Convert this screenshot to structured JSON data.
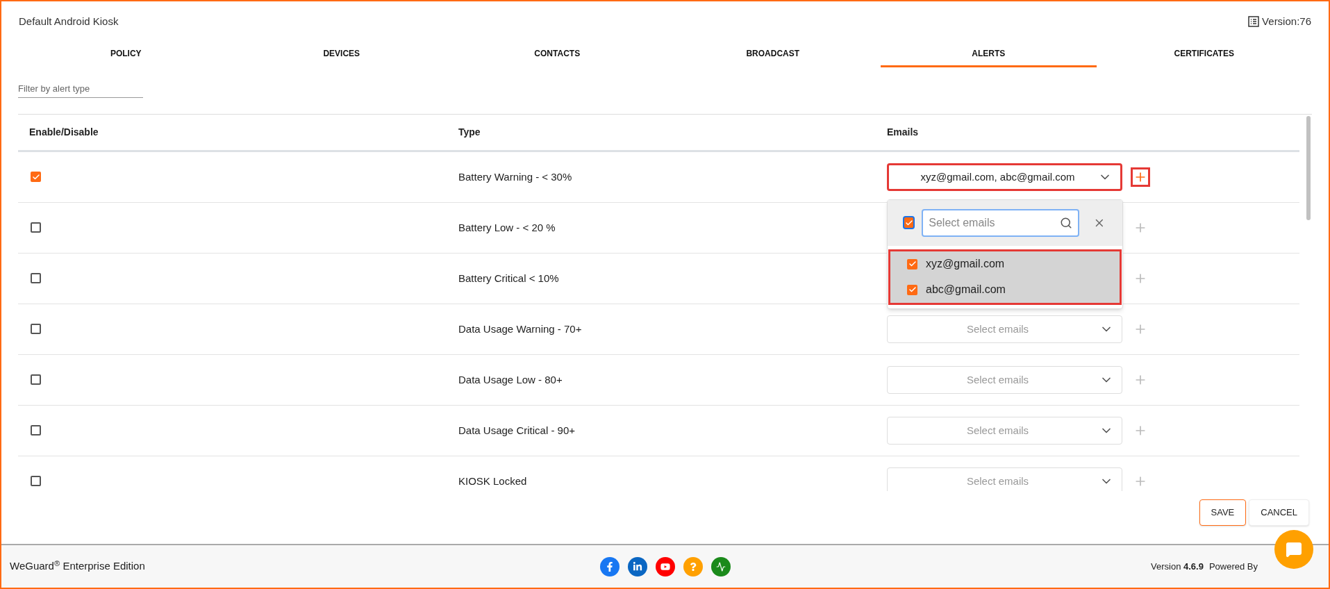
{
  "header": {
    "title": "Default Android Kiosk",
    "version": "Version:76"
  },
  "tabs": [
    {
      "label": "POLICY",
      "selected": false
    },
    {
      "label": "DEVICES",
      "selected": false
    },
    {
      "label": "CONTACTS",
      "selected": false
    },
    {
      "label": "BROADCAST",
      "selected": false
    },
    {
      "label": "ALERTS",
      "selected": true
    },
    {
      "label": "CERTIFICATES",
      "selected": false
    }
  ],
  "filter": {
    "placeholder": "Filter by alert type"
  },
  "table": {
    "columns": [
      "Enable/Disable",
      "Type",
      "Emails"
    ],
    "rows": [
      {
        "enabled": true,
        "type": "Battery Warning - < 30%",
        "emails": "xyz@gmail.com, abc@gmail.com",
        "highlighted": true,
        "add_active": true
      },
      {
        "enabled": false,
        "type": "Battery Low - < 20 %",
        "highlighted": false,
        "add_active": false
      },
      {
        "enabled": false,
        "type": "Battery Critical < 10%",
        "highlighted": false,
        "add_active": false
      },
      {
        "enabled": false,
        "type": "Data Usage Warning - 70+",
        "placeholder": "Select emails",
        "highlighted": false,
        "add_active": false
      },
      {
        "enabled": false,
        "type": "Data Usage Low - 80+",
        "placeholder": "Select emails",
        "highlighted": false,
        "add_active": false
      },
      {
        "enabled": false,
        "type": "Data Usage Critical - 90+",
        "placeholder": "Select emails",
        "highlighted": false,
        "add_active": false
      },
      {
        "enabled": false,
        "type": "KIOSK Locked",
        "placeholder": "Select emails",
        "highlighted": false,
        "add_active": false
      }
    ]
  },
  "email_dropdown": {
    "all_checked": true,
    "search_placeholder": "Select emails",
    "highlighted": true,
    "options": [
      {
        "label": "xyz@gmail.com",
        "checked": true
      },
      {
        "label": "abc@gmail.com",
        "checked": true
      }
    ]
  },
  "buttons": [
    {
      "label": "SAVE",
      "kind": "primary"
    },
    {
      "label": "CANCEL",
      "kind": "secondary"
    }
  ],
  "footer": {
    "brand": "WeGuard$^{®}$ Enterprise Edition",
    "version": "Version **4.6.9**",
    "powered": "Powered By"
  }
}
